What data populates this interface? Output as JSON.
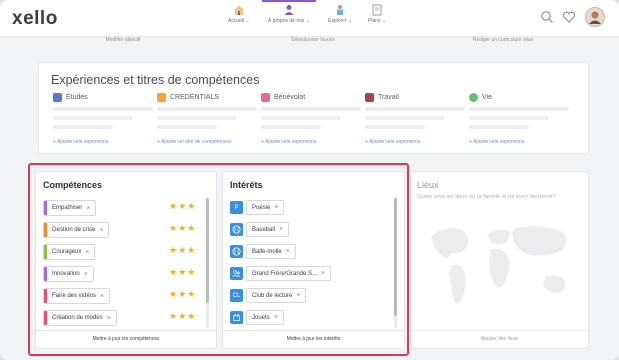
{
  "app": {
    "logo": "xello"
  },
  "nav": {
    "items": [
      {
        "label": "Accueil ⌄",
        "icon": "home-icon",
        "active": false
      },
      {
        "label": "À propos de moi ⌄",
        "icon": "person-icon",
        "active": true
      },
      {
        "label": "Explorer ⌄",
        "icon": "explorer-icon",
        "active": false
      },
      {
        "label": "Plans ⌄",
        "icon": "plans-icon",
        "active": false
      }
    ],
    "right_icons": [
      "search-icon",
      "heart-icon",
      "avatar"
    ]
  },
  "actions": [
    "Modifier objectif",
    "Sélectionner favoris",
    "Rédiger un curriculum vitae"
  ],
  "experiences": {
    "title": "Expériences et titres de compétences",
    "columns": [
      {
        "label": "Études",
        "icon": "studies-icon",
        "color": "#5a78c9",
        "add": "+ Ajouter une expérience"
      },
      {
        "label": "CREDENTIALS",
        "icon": "credentials-icon",
        "color": "#f2a33a",
        "add": "+ Ajouter un titre de compétences"
      },
      {
        "label": "Bénévolat",
        "icon": "volunteer-icon",
        "color": "#e46a8e",
        "add": "+ Ajouter une expérience"
      },
      {
        "label": "Travail",
        "icon": "work-icon",
        "color": "#a9464a",
        "add": "+ Ajouter une expérience"
      },
      {
        "label": "Vie",
        "icon": "life-icon",
        "color": "#5cc46d",
        "add": "+ Ajouter une expérience"
      }
    ]
  },
  "skills": {
    "title": "Compétences",
    "footer": "Mettre à jour les compétences",
    "stars": "★★★",
    "items": [
      {
        "label": "Empathiser",
        "color": "#a86ad8",
        "rating": 3
      },
      {
        "label": "Gestion de crise",
        "color": "#f28a2e",
        "rating": 3
      },
      {
        "label": "Courageux",
        "color": "#8bc34a",
        "rating": 3
      },
      {
        "label": "Innovation",
        "color": "#a86ad8",
        "rating": 3
      },
      {
        "label": "Faire des vidéos",
        "color": "#e8507a",
        "rating": 3
      },
      {
        "label": "Création de modes",
        "color": "#e8507a",
        "rating": 3
      }
    ]
  },
  "interests": {
    "title": "Intérêts",
    "footer": "Mettre à jour les intérêts",
    "items": [
      {
        "label": "Poésie",
        "icon_text": "P",
        "icon": "poetry-icon"
      },
      {
        "label": "Baseball",
        "icon_text": "",
        "icon": "baseball-icon"
      },
      {
        "label": "Balle-molle",
        "icon_text": "",
        "icon": "softball-icon"
      },
      {
        "label": "Grand Frère/Grande S...",
        "icon_text": "",
        "icon": "mentor-icon"
      },
      {
        "label": "Club de lecture",
        "icon_text": "CL",
        "icon": "book-club-icon"
      },
      {
        "label": "Jouets",
        "icon_text": "",
        "icon": "toys-icon"
      }
    ]
  },
  "places": {
    "title": "Lieux",
    "text": "Quels sont les lieux où ta famille et toi avez demeuré?",
    "footer": "Ajouter des lieux"
  }
}
